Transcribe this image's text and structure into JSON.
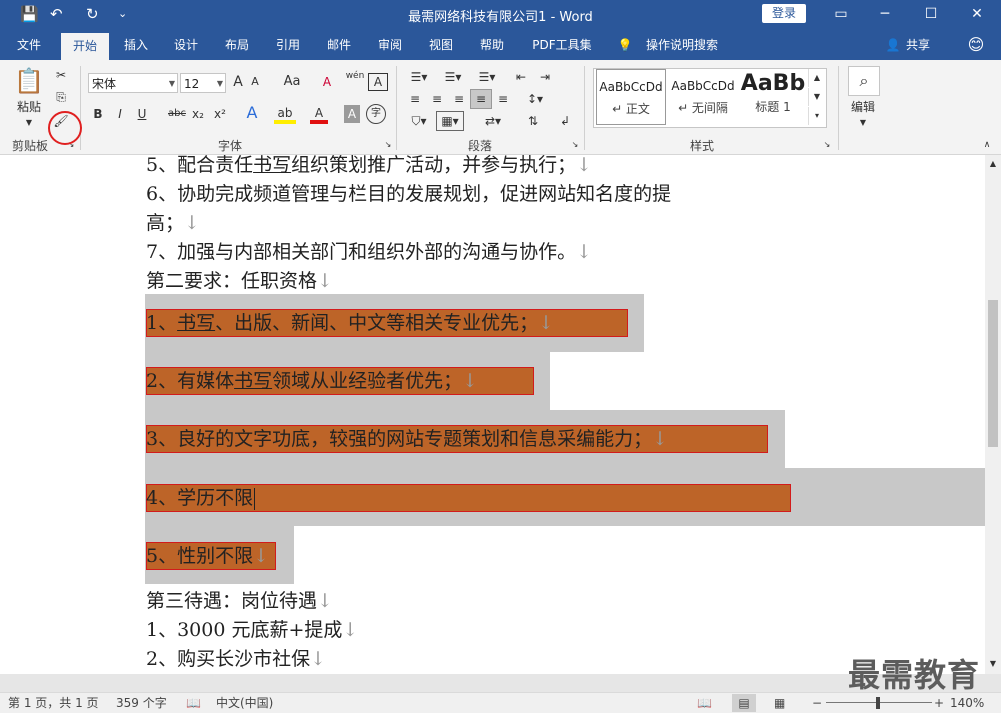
{
  "window": {
    "title": "最需网络科技有限公司1  -  Word",
    "login": "登录",
    "minimize": "─",
    "restore": "☐",
    "close": "✕"
  },
  "qat": {
    "save": "💾",
    "undo": "↶",
    "redo": "↻",
    "more": "⌄"
  },
  "tabs": [
    "文件",
    "开始",
    "插入",
    "设计",
    "布局",
    "引用",
    "邮件",
    "审阅",
    "视图",
    "帮助",
    "PDF工具集"
  ],
  "tell_me": "操作说明搜索",
  "share": "共享",
  "ribbon": {
    "clipboard": {
      "paste": "粘贴",
      "label": "剪贴板"
    },
    "font": {
      "name": "宋体",
      "size": "12",
      "label": "字体",
      "bold": "B",
      "italic": "I",
      "underline": "U",
      "strike": "abc",
      "sub": "x₂",
      "sup": "x²",
      "grow": "A",
      "shrink": "A",
      "case": "Aa",
      "clear": "A",
      "pinyin": "wén",
      "border": "A",
      "effect": "A",
      "highlight": "ab",
      "color": "A",
      "shade": "A",
      "enclose": "字"
    },
    "paragraph": {
      "label": "段落"
    },
    "styles": {
      "label": "样式",
      "items": [
        {
          "sample": "AaBbCcDd",
          "name": "↵ 正文"
        },
        {
          "sample": "AaBbCcDd",
          "name": "↵ 无间隔"
        },
        {
          "sample": "AaBb",
          "name": "标题 1"
        }
      ]
    },
    "editing": {
      "label": "编辑"
    }
  },
  "document": {
    "lines": [
      {
        "pre": "5、配合责任",
        "u": "书写",
        "post": "组织策划推广活动，并参与执行；",
        "mark": "↓"
      },
      {
        "pre": "6、协助完成频道管理与栏目的发展规划，促进网站知名度的提",
        "u": "",
        "post": "",
        "mark": ""
      },
      {
        "pre": "高；",
        "u": "",
        "post": "",
        "mark": "↓"
      },
      {
        "pre": "7、加强与内部相关部门和组织外部的沟通与协作。",
        "u": "",
        "post": "",
        "mark": "↓"
      },
      {
        "pre": "第二要求：任职资格",
        "u": "",
        "post": "",
        "mark": "↓"
      }
    ],
    "selected": [
      {
        "pre": "1、",
        "u": "书写",
        "post": "、出版、新闻、中文等相关专业优先；",
        "mark": "↓"
      },
      {
        "pre": "2、有媒体",
        "u": "书写",
        "post": "领域从业经验者优先；",
        "mark": "↓"
      },
      {
        "pre": "3、良好的文字功底，较强的网站专题策划和信息采编能力；",
        "u": "",
        "post": "",
        "mark": "↓"
      },
      {
        "pre": "4、学历不限",
        "u": "",
        "post": "",
        "mark": ""
      },
      {
        "pre": "5、性别不限",
        "u": "",
        "post": "",
        "mark": "↓"
      }
    ],
    "after": [
      {
        "pre": "第三待遇：岗位待遇",
        "mark": "↓"
      },
      {
        "pre": "1、3000 元底薪+提成",
        "mark": "↓"
      },
      {
        "pre": "2、购买长沙市社保",
        "mark": "↓"
      }
    ]
  },
  "status": {
    "page": "第 1 页，共 1 页",
    "words": "359 个字",
    "lang": "中文(中国)",
    "zoom": "140%",
    "minus": "−",
    "plus": "+"
  },
  "watermark": "最需教育"
}
